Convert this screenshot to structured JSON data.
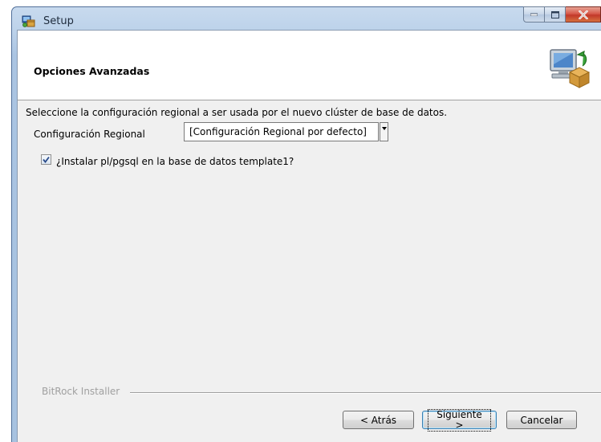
{
  "window": {
    "title": "Setup",
    "controls": {
      "minimize": "minimize-icon",
      "maximize": "maximize-icon",
      "close": "close-icon"
    }
  },
  "header": {
    "title": "Opciones Avanzadas",
    "icon": "computer-package-icon"
  },
  "body": {
    "description": "Seleccione la configuración regional a ser usada por el nuevo clúster de base de datos.",
    "locale_label": "Configuración Regional",
    "locale_value": "[Configuración Regional por defecto]",
    "install_plpgsql": {
      "label": "¿Instalar pl/pgsql en la base de datos template1?",
      "checked": true
    }
  },
  "footer": {
    "brand": "BitRock Installer",
    "back_label": "< Atrás",
    "next_label": "Siguiente >",
    "cancel_label": "Cancelar"
  },
  "colors": {
    "frame": "#a9c3e1",
    "client": "#f0f0f0",
    "close_button": "#c7432f",
    "focus_border": "#3c7fb1"
  }
}
